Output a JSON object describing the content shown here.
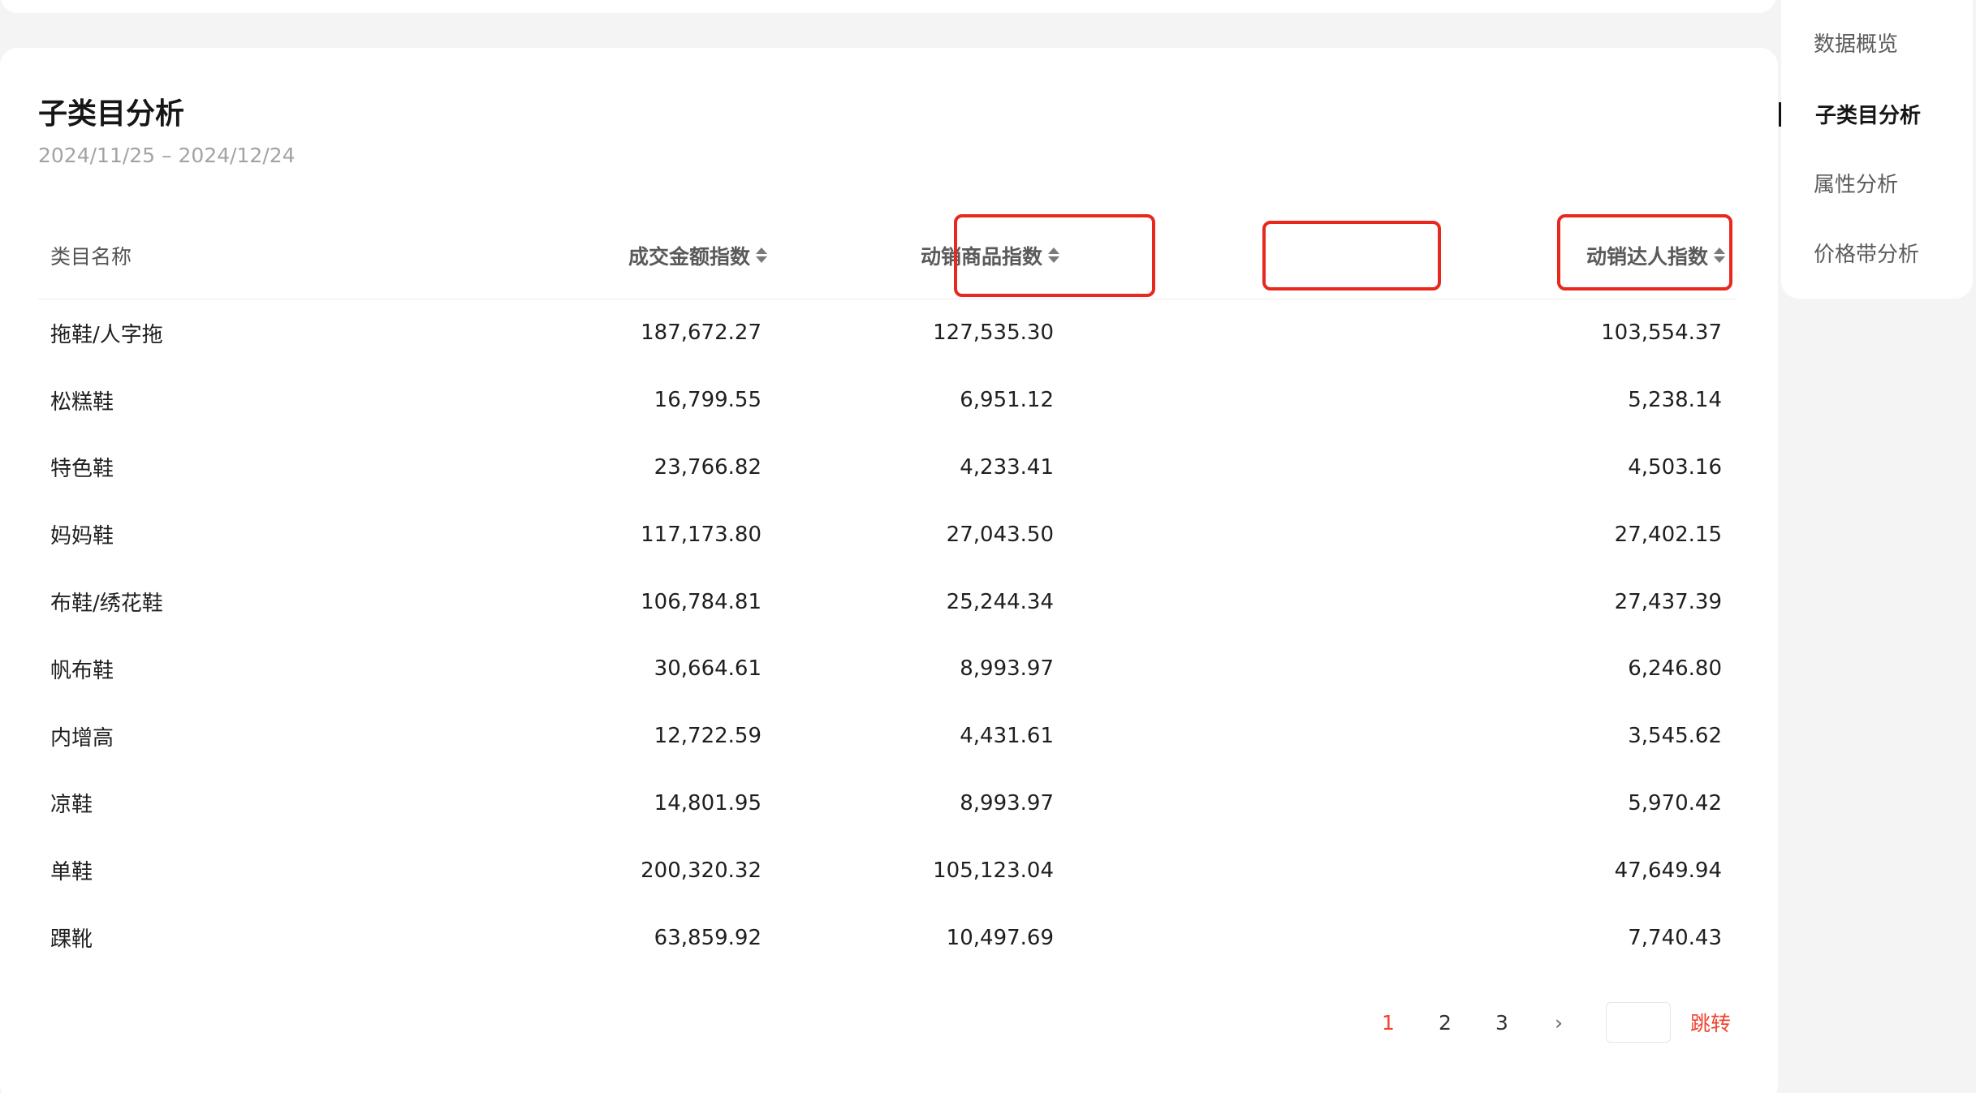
{
  "page": {
    "title": "子类目分析",
    "date_range": "2024/11/25 – 2024/12/24"
  },
  "table": {
    "columns": {
      "name": "类目名称",
      "gmv_index": "成交金额指数",
      "product_index": "动销商品指数",
      "influencer_index": "动销达人指数"
    },
    "rows": [
      {
        "name": "拖鞋/人字拖",
        "gmv": "187,672.27",
        "product": "127,535.30",
        "influencer": "103,554.37"
      },
      {
        "name": "松糕鞋",
        "gmv": "16,799.55",
        "product": "6,951.12",
        "influencer": "5,238.14"
      },
      {
        "name": "特色鞋",
        "gmv": "23,766.82",
        "product": "4,233.41",
        "influencer": "4,503.16"
      },
      {
        "name": "妈妈鞋",
        "gmv": "117,173.80",
        "product": "27,043.50",
        "influencer": "27,402.15"
      },
      {
        "name": "布鞋/绣花鞋",
        "gmv": "106,784.81",
        "product": "25,244.34",
        "influencer": "27,437.39"
      },
      {
        "name": "帆布鞋",
        "gmv": "30,664.61",
        "product": "8,993.97",
        "influencer": "6,246.80"
      },
      {
        "name": "内增高",
        "gmv": "12,722.59",
        "product": "4,431.61",
        "influencer": "3,545.62"
      },
      {
        "name": "凉鞋",
        "gmv": "14,801.95",
        "product": "8,993.97",
        "influencer": "5,970.42"
      },
      {
        "name": "单鞋",
        "gmv": "200,320.32",
        "product": "105,123.04",
        "influencer": "47,649.94"
      },
      {
        "name": "踝靴",
        "gmv": "63,859.92",
        "product": "10,497.69",
        "influencer": "7,740.43"
      }
    ]
  },
  "pagination": {
    "pages": [
      "1",
      "2",
      "3"
    ],
    "current": "1",
    "next": "›",
    "jump_value": "",
    "jump_label": "跳转"
  },
  "side_nav": {
    "items": [
      "数据概览",
      "子类目分析",
      "属性分析",
      "价格带分析"
    ],
    "active": "子类目分析"
  },
  "colors": {
    "accent": "#f0442f",
    "highlight_box": "#e8281f",
    "background": "#f4f4f4"
  }
}
